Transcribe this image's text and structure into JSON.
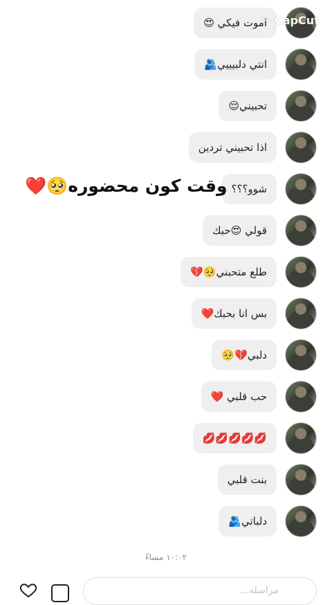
{
  "messages": [
    {
      "text": "اموت فيكي 😍"
    },
    {
      "text": "انتي دلبيييي🫂"
    },
    {
      "text": "تحبيني😌"
    },
    {
      "text": "اذا تحبيني تردين"
    },
    {
      "text": "شوو؟؟؟"
    },
    {
      "text": "قولي 😍حبك"
    },
    {
      "text": "طلع متحبني🥺💔"
    },
    {
      "text": "بس انا بحبك❤️"
    },
    {
      "text": "دلبي💔🥺"
    },
    {
      "text": "حب قلبي ❤️"
    },
    {
      "text": "💋💋💋💋💋"
    },
    {
      "text": "بنت قلبي"
    },
    {
      "text": "دلباتي🫂"
    }
  ],
  "overlay": {
    "caption": "وقت كون محضوره🥺❤️"
  },
  "watermark": {
    "text": "CapCut"
  },
  "timestamp": "١٠:٠٢ مساءً",
  "composer": {
    "placeholder": "مراسلة..."
  },
  "icons": {
    "avatar": "avatar-photo",
    "emoji": "smiley-icon",
    "left_a": "heart-outline-icon",
    "left_b": "image-icon",
    "watermark_logo": "capcut-logo-icon"
  }
}
